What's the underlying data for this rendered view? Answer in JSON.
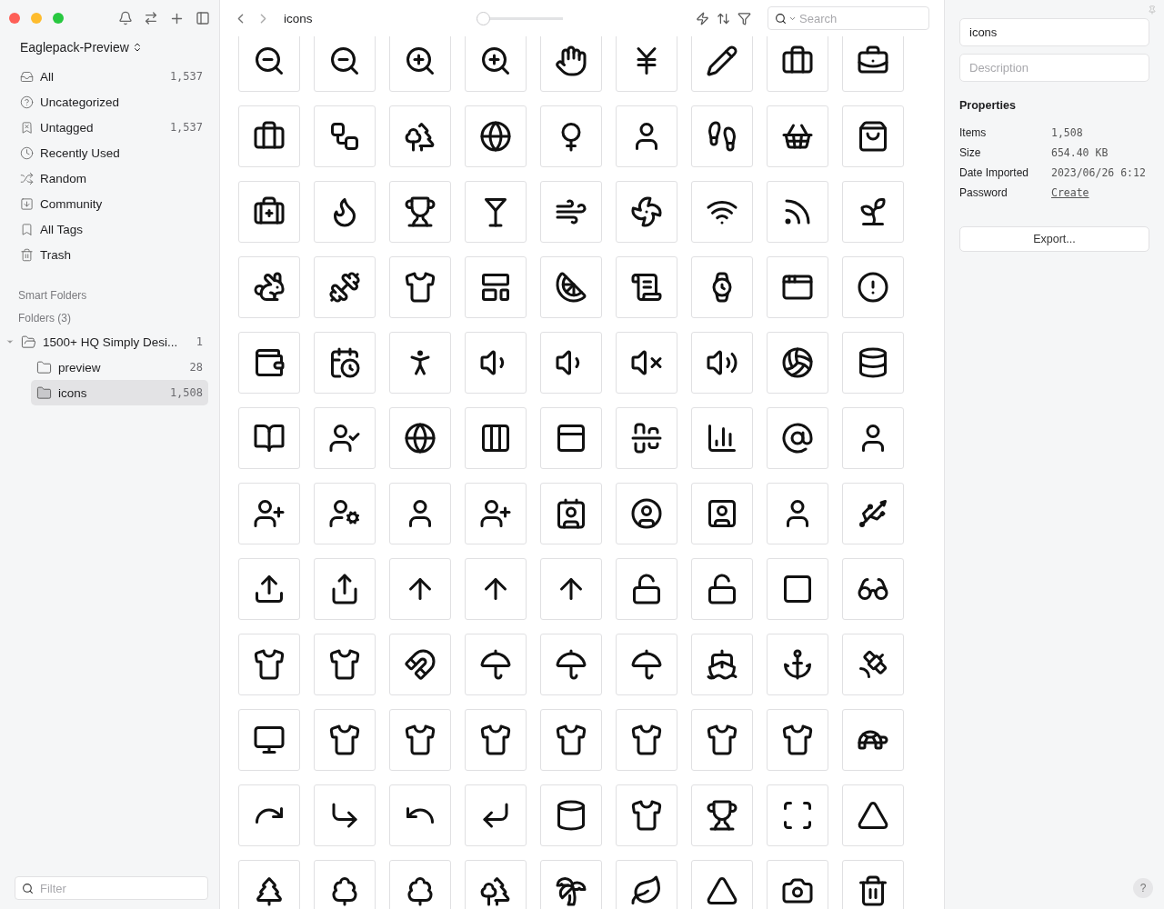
{
  "sidebar": {
    "library": "Eaglepack-Preview",
    "nav": [
      {
        "label": "All",
        "count": "1,537",
        "selected": false
      },
      {
        "label": "Uncategorized",
        "selected": false
      },
      {
        "label": "Untagged",
        "count": "1,537",
        "selected": false
      },
      {
        "label": "Recently Used",
        "selected": false
      },
      {
        "label": "Random",
        "selected": false
      },
      {
        "label": "Community",
        "selected": false
      },
      {
        "label": "All Tags",
        "selected": false
      },
      {
        "label": "Trash",
        "selected": false
      }
    ],
    "smart_folders": "Smart Folders",
    "folders_heading": "Folders (3)",
    "folders": [
      {
        "label": "1500+ HQ Simply Desi...",
        "count": "1",
        "expanded": true,
        "selected": false,
        "children": [
          {
            "label": "preview",
            "count": "28",
            "selected": false
          },
          {
            "label": "icons",
            "count": "1,508",
            "selected": true
          }
        ]
      }
    ],
    "filter": {
      "placeholder": "Filter"
    }
  },
  "toolbar": {
    "title": "icons",
    "zoom": {
      "level": 0.04
    },
    "search": {
      "placeholder": "Search"
    }
  },
  "inspector": {
    "name": "icons",
    "description": {
      "placeholder": "Description"
    },
    "properties_heading": "Properties",
    "properties": [
      {
        "label": "Items",
        "value": "1,508"
      },
      {
        "label": "Size",
        "value": "654.40 KB"
      },
      {
        "label": "Date Imported",
        "value": "2023/06/26 6:12"
      },
      {
        "label": "Password",
        "value": "Create",
        "kind": "link"
      }
    ],
    "export": "Export...",
    "help": "?"
  }
}
